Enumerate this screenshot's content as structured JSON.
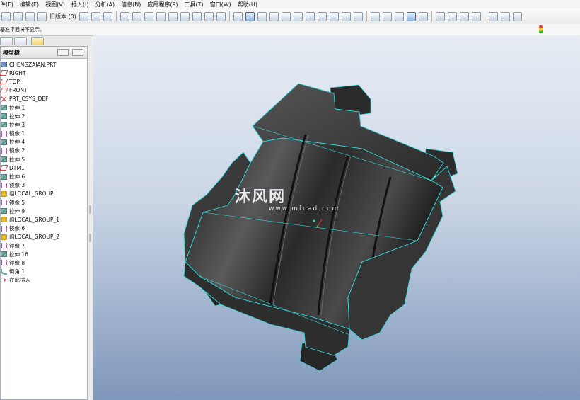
{
  "menu": [
    "件(F)",
    "编辑(E)",
    "视图(V)",
    "插入(I)",
    "分析(A)",
    "信息(N)",
    "应用程序(P)",
    "工具(T)",
    "窗口(W)",
    "帮助(H)"
  ],
  "toolbar": {
    "revision_label": "旧版本 (0)"
  },
  "message": "基准平面将不显示。",
  "model_tree": {
    "title": "模型树",
    "items": [
      {
        "label": "CHENGZAIAN.PRT",
        "icon": "part-icon"
      },
      {
        "label": "RIGHT",
        "icon": "datum-plane-icon"
      },
      {
        "label": "TOP",
        "icon": "datum-plane-icon"
      },
      {
        "label": "FRONT",
        "icon": "datum-plane-icon"
      },
      {
        "label": "PRT_CSYS_DEF",
        "icon": "coordinate-system-icon"
      },
      {
        "label": "拉伸 1",
        "icon": "extrude-icon"
      },
      {
        "label": "拉伸 2",
        "icon": "extrude-icon"
      },
      {
        "label": "拉伸 3",
        "icon": "extrude-icon"
      },
      {
        "label": "镜像 1",
        "icon": "mirror-icon"
      },
      {
        "label": "拉伸 4",
        "icon": "extrude-icon"
      },
      {
        "label": "镜像 2",
        "icon": "mirror-icon"
      },
      {
        "label": "拉伸 5",
        "icon": "extrude-icon"
      },
      {
        "label": "DTM1",
        "icon": "datum-plane-icon"
      },
      {
        "label": "拉伸 6",
        "icon": "extrude-icon"
      },
      {
        "label": "镜像 3",
        "icon": "mirror-icon"
      },
      {
        "label": "组LOCAL_GROUP",
        "icon": "group-icon"
      },
      {
        "label": "镜像 5",
        "icon": "mirror-icon"
      },
      {
        "label": "拉伸 9",
        "icon": "extrude-icon"
      },
      {
        "label": "组LOCAL_GROUP_1",
        "icon": "group-icon"
      },
      {
        "label": "镜像 6",
        "icon": "mirror-icon"
      },
      {
        "label": "组LOCAL_GROUP_2",
        "icon": "group-icon"
      },
      {
        "label": "镜像 7",
        "icon": "mirror-icon"
      },
      {
        "label": "拉伸 16",
        "icon": "extrude-icon"
      },
      {
        "label": "镜像 8",
        "icon": "mirror-icon"
      },
      {
        "label": "倒角 1",
        "icon": "round-icon"
      },
      {
        "label": "在此插入",
        "icon": "insert-here-icon"
      }
    ]
  },
  "watermark": {
    "text": "沐风网",
    "url": "www.mfcad.com"
  },
  "colors": {
    "edge_highlight": "#31d6d8",
    "model_dark": "#2c2c2c",
    "viewport_bottom": "#7f97bb"
  }
}
